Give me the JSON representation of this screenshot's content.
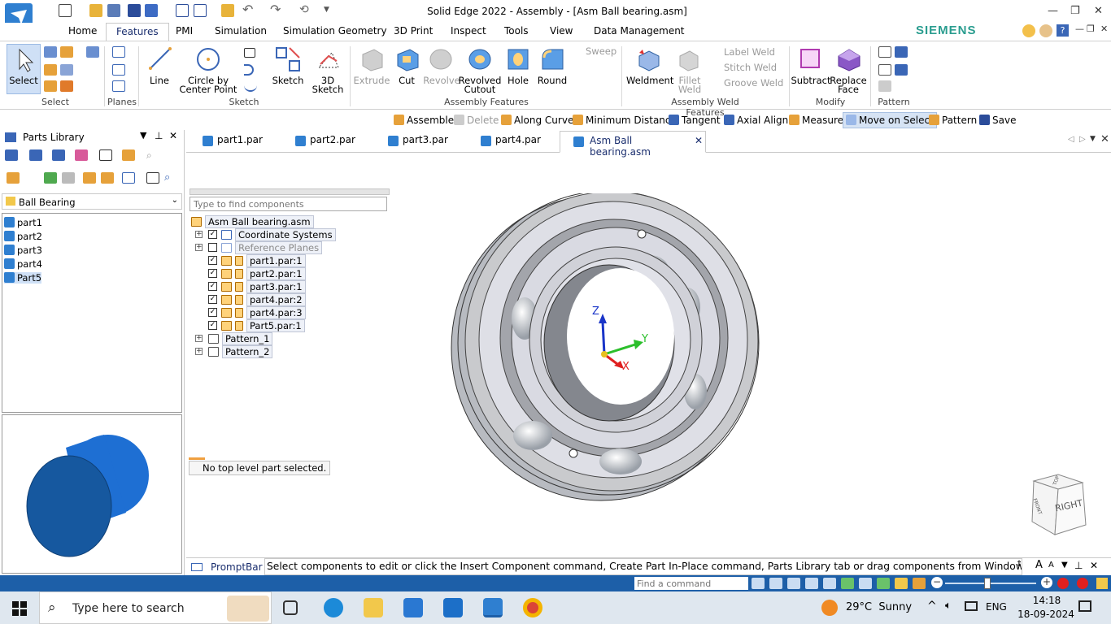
{
  "app": {
    "title": "Solid Edge 2022 - Assembly - [Asm Ball bearing.asm]",
    "brand": "SIEMENS",
    "colors": {
      "accent": "#1d5fa8",
      "brand": "#2a9d8f",
      "part_blue": "#1a6fd0"
    }
  },
  "ribbon_tabs": [
    "Home",
    "Features",
    "PMI",
    "Simulation",
    "Simulation Geometry",
    "3D Print",
    "Inspect",
    "Tools",
    "View",
    "Data Management"
  ],
  "active_tab": "Features",
  "ribbon": {
    "select": "Select",
    "groups": {
      "select": "Select",
      "planes": "Planes",
      "sketch": "Sketch",
      "assembly_features": "Assembly Features",
      "weld": "Assembly Weld Features",
      "modify": "Modify",
      "pattern": "Pattern"
    },
    "line": "Line",
    "circle1": "Circle by",
    "circle2": "Center Point",
    "sketch": "Sketch",
    "sketch3d1": "3D",
    "sketch3d2": "Sketch",
    "extrude": "Extrude",
    "cut": "Cut",
    "revolve": "Revolve",
    "revcut1": "Revolved",
    "revcut2": "Cutout",
    "hole": "Hole",
    "round": "Round",
    "sweep": "Sweep",
    "weldment": "Weldment",
    "fillet1": "Fillet",
    "fillet2": "Weld",
    "label_weld": "Label Weld",
    "stitch_weld": "Stitch Weld",
    "groove_weld": "Groove Weld",
    "subtract": "Subtract",
    "replace1": "Replace",
    "replace2": "Face"
  },
  "command_bar": [
    "Assemble",
    "Delete",
    "Along Curve",
    "Minimum Distance",
    "Tangent",
    "Axial Align",
    "Measure",
    "Move on Select",
    "Pattern",
    "Save"
  ],
  "parts_library": {
    "title": "Parts Library",
    "folder": "Ball Bearing",
    "items": [
      "part1",
      "part2",
      "part3",
      "part4",
      "Part5"
    ]
  },
  "doc_tabs": [
    "part1.par",
    "part2.par",
    "part3.par",
    "part4.par",
    "Asm Ball bearing.asm"
  ],
  "pathfinder": {
    "search_placeholder": "Type to find components",
    "root": "Asm Ball bearing.asm",
    "nodes": [
      "Coordinate Systems",
      "Reference Planes",
      "part1.par:1",
      "part2.par:1",
      "part3.par:1",
      "part4.par:2",
      "part4.par:3",
      "Part5.par:1",
      "Pattern_1",
      "Pattern_2"
    ],
    "status": "No top level part selected."
  },
  "axes": {
    "z": "Z",
    "y": "Y",
    "x": "X"
  },
  "view_cube": {
    "face": "RIGHT",
    "top": "TOP",
    "front": "FRONT"
  },
  "prompt": {
    "label": "PromptBar",
    "text": "Select components to edit or click the Insert Component command, Create Part In-Place command, Parts Library tab or drag components from Windows"
  },
  "status_bar": {
    "find_placeholder": "Find a command"
  },
  "taskbar": {
    "search": "Type here to search",
    "weather": "29°C  Sunny",
    "lang": "ENG",
    "time": "14:18",
    "date": "18-09-2024"
  }
}
